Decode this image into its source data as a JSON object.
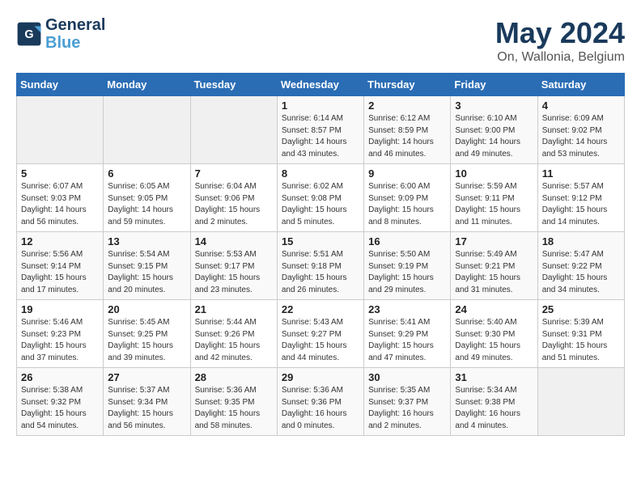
{
  "header": {
    "logo_line1": "General",
    "logo_line2": "Blue",
    "title": "May 2024",
    "subtitle": "On, Wallonia, Belgium"
  },
  "weekdays": [
    "Sunday",
    "Monday",
    "Tuesday",
    "Wednesday",
    "Thursday",
    "Friday",
    "Saturday"
  ],
  "weeks": [
    [
      {
        "day": "",
        "sunrise": "",
        "sunset": "",
        "daylight": ""
      },
      {
        "day": "",
        "sunrise": "",
        "sunset": "",
        "daylight": ""
      },
      {
        "day": "",
        "sunrise": "",
        "sunset": "",
        "daylight": ""
      },
      {
        "day": "1",
        "sunrise": "Sunrise: 6:14 AM",
        "sunset": "Sunset: 8:57 PM",
        "daylight": "Daylight: 14 hours and 43 minutes."
      },
      {
        "day": "2",
        "sunrise": "Sunrise: 6:12 AM",
        "sunset": "Sunset: 8:59 PM",
        "daylight": "Daylight: 14 hours and 46 minutes."
      },
      {
        "day": "3",
        "sunrise": "Sunrise: 6:10 AM",
        "sunset": "Sunset: 9:00 PM",
        "daylight": "Daylight: 14 hours and 49 minutes."
      },
      {
        "day": "4",
        "sunrise": "Sunrise: 6:09 AM",
        "sunset": "Sunset: 9:02 PM",
        "daylight": "Daylight: 14 hours and 53 minutes."
      }
    ],
    [
      {
        "day": "5",
        "sunrise": "Sunrise: 6:07 AM",
        "sunset": "Sunset: 9:03 PM",
        "daylight": "Daylight: 14 hours and 56 minutes."
      },
      {
        "day": "6",
        "sunrise": "Sunrise: 6:05 AM",
        "sunset": "Sunset: 9:05 PM",
        "daylight": "Daylight: 14 hours and 59 minutes."
      },
      {
        "day": "7",
        "sunrise": "Sunrise: 6:04 AM",
        "sunset": "Sunset: 9:06 PM",
        "daylight": "Daylight: 15 hours and 2 minutes."
      },
      {
        "day": "8",
        "sunrise": "Sunrise: 6:02 AM",
        "sunset": "Sunset: 9:08 PM",
        "daylight": "Daylight: 15 hours and 5 minutes."
      },
      {
        "day": "9",
        "sunrise": "Sunrise: 6:00 AM",
        "sunset": "Sunset: 9:09 PM",
        "daylight": "Daylight: 15 hours and 8 minutes."
      },
      {
        "day": "10",
        "sunrise": "Sunrise: 5:59 AM",
        "sunset": "Sunset: 9:11 PM",
        "daylight": "Daylight: 15 hours and 11 minutes."
      },
      {
        "day": "11",
        "sunrise": "Sunrise: 5:57 AM",
        "sunset": "Sunset: 9:12 PM",
        "daylight": "Daylight: 15 hours and 14 minutes."
      }
    ],
    [
      {
        "day": "12",
        "sunrise": "Sunrise: 5:56 AM",
        "sunset": "Sunset: 9:14 PM",
        "daylight": "Daylight: 15 hours and 17 minutes."
      },
      {
        "day": "13",
        "sunrise": "Sunrise: 5:54 AM",
        "sunset": "Sunset: 9:15 PM",
        "daylight": "Daylight: 15 hours and 20 minutes."
      },
      {
        "day": "14",
        "sunrise": "Sunrise: 5:53 AM",
        "sunset": "Sunset: 9:17 PM",
        "daylight": "Daylight: 15 hours and 23 minutes."
      },
      {
        "day": "15",
        "sunrise": "Sunrise: 5:51 AM",
        "sunset": "Sunset: 9:18 PM",
        "daylight": "Daylight: 15 hours and 26 minutes."
      },
      {
        "day": "16",
        "sunrise": "Sunrise: 5:50 AM",
        "sunset": "Sunset: 9:19 PM",
        "daylight": "Daylight: 15 hours and 29 minutes."
      },
      {
        "day": "17",
        "sunrise": "Sunrise: 5:49 AM",
        "sunset": "Sunset: 9:21 PM",
        "daylight": "Daylight: 15 hours and 31 minutes."
      },
      {
        "day": "18",
        "sunrise": "Sunrise: 5:47 AM",
        "sunset": "Sunset: 9:22 PM",
        "daylight": "Daylight: 15 hours and 34 minutes."
      }
    ],
    [
      {
        "day": "19",
        "sunrise": "Sunrise: 5:46 AM",
        "sunset": "Sunset: 9:23 PM",
        "daylight": "Daylight: 15 hours and 37 minutes."
      },
      {
        "day": "20",
        "sunrise": "Sunrise: 5:45 AM",
        "sunset": "Sunset: 9:25 PM",
        "daylight": "Daylight: 15 hours and 39 minutes."
      },
      {
        "day": "21",
        "sunrise": "Sunrise: 5:44 AM",
        "sunset": "Sunset: 9:26 PM",
        "daylight": "Daylight: 15 hours and 42 minutes."
      },
      {
        "day": "22",
        "sunrise": "Sunrise: 5:43 AM",
        "sunset": "Sunset: 9:27 PM",
        "daylight": "Daylight: 15 hours and 44 minutes."
      },
      {
        "day": "23",
        "sunrise": "Sunrise: 5:41 AM",
        "sunset": "Sunset: 9:29 PM",
        "daylight": "Daylight: 15 hours and 47 minutes."
      },
      {
        "day": "24",
        "sunrise": "Sunrise: 5:40 AM",
        "sunset": "Sunset: 9:30 PM",
        "daylight": "Daylight: 15 hours and 49 minutes."
      },
      {
        "day": "25",
        "sunrise": "Sunrise: 5:39 AM",
        "sunset": "Sunset: 9:31 PM",
        "daylight": "Daylight: 15 hours and 51 minutes."
      }
    ],
    [
      {
        "day": "26",
        "sunrise": "Sunrise: 5:38 AM",
        "sunset": "Sunset: 9:32 PM",
        "daylight": "Daylight: 15 hours and 54 minutes."
      },
      {
        "day": "27",
        "sunrise": "Sunrise: 5:37 AM",
        "sunset": "Sunset: 9:34 PM",
        "daylight": "Daylight: 15 hours and 56 minutes."
      },
      {
        "day": "28",
        "sunrise": "Sunrise: 5:36 AM",
        "sunset": "Sunset: 9:35 PM",
        "daylight": "Daylight: 15 hours and 58 minutes."
      },
      {
        "day": "29",
        "sunrise": "Sunrise: 5:36 AM",
        "sunset": "Sunset: 9:36 PM",
        "daylight": "Daylight: 16 hours and 0 minutes."
      },
      {
        "day": "30",
        "sunrise": "Sunrise: 5:35 AM",
        "sunset": "Sunset: 9:37 PM",
        "daylight": "Daylight: 16 hours and 2 minutes."
      },
      {
        "day": "31",
        "sunrise": "Sunrise: 5:34 AM",
        "sunset": "Sunset: 9:38 PM",
        "daylight": "Daylight: 16 hours and 4 minutes."
      },
      {
        "day": "",
        "sunrise": "",
        "sunset": "",
        "daylight": ""
      }
    ]
  ]
}
